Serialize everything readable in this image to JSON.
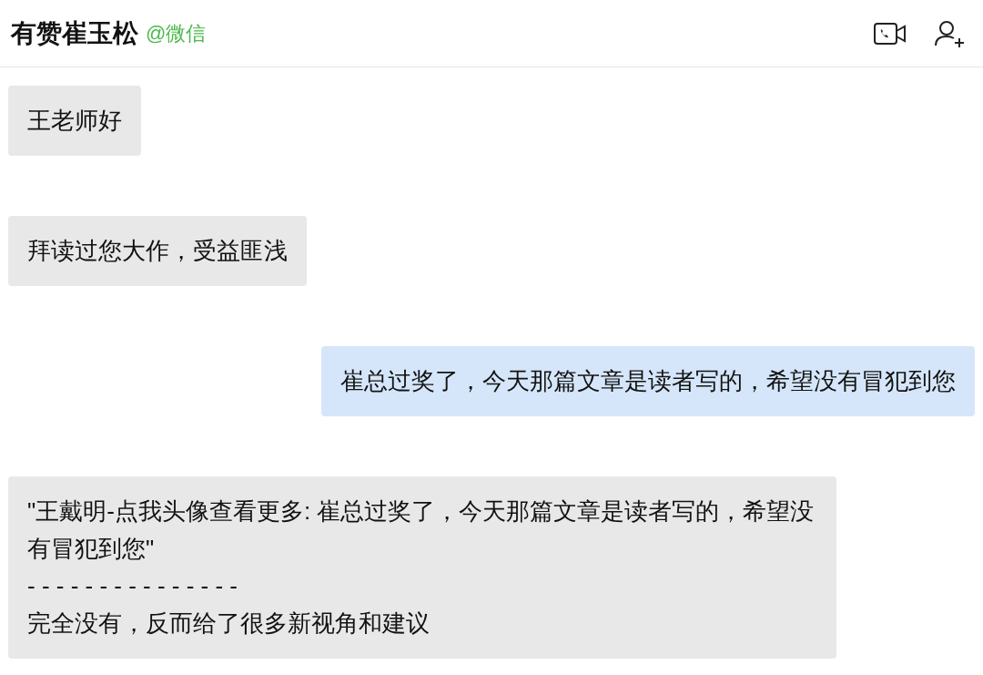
{
  "header": {
    "title": "有赞崔玉松",
    "source": "@微信"
  },
  "messages": [
    {
      "kind": "received",
      "text": "王老师好"
    },
    {
      "kind": "received",
      "text": "拜读过您大作，受益匪浅"
    },
    {
      "kind": "sent",
      "text": "崔总过奖了，今天那篇文章是读者写的，希望没有冒犯到您"
    },
    {
      "kind": "quote_reply",
      "quote": "\"王戴明-点我头像查看更多: 崔总过奖了，今天那篇文章是读者写的，希望没有冒犯到您\"",
      "separator": "- - - - - - - - - - - - - - -",
      "reply": "完全没有，反而给了很多新视角和建议"
    }
  ]
}
